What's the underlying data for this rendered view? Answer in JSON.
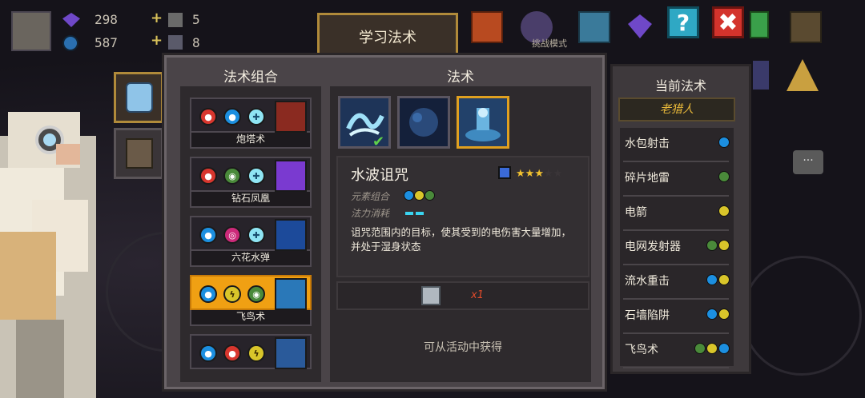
{
  "hud": {
    "gems": "298",
    "gold_coins": "587",
    "material_a": "5",
    "material_b": "8",
    "plus_a": "+",
    "plus_b": "+"
  },
  "buttons": {
    "learn_tab": "学习法术",
    "help": "?",
    "close": "✖",
    "chat": "···"
  },
  "background": {
    "mode_hint": "挑战模式"
  },
  "combos": {
    "title": "法术组合",
    "items": [
      {
        "name": "炮塔术",
        "elements": [
          "fire",
          "water",
          "ice"
        ],
        "art_color": "#8a2a20",
        "active": false
      },
      {
        "name": "钻石凤凰",
        "elements": [
          "fire",
          "earth",
          "ice"
        ],
        "art_color": "#7a3ad0",
        "active": false
      },
      {
        "name": "六花水弹",
        "elements": [
          "water",
          "poison",
          "ice"
        ],
        "art_color": "#1c4a9a",
        "active": false
      },
      {
        "name": "飞鸟术",
        "elements": [
          "water",
          "elec",
          "earth"
        ],
        "art_color": "#2a78b8",
        "active": true
      },
      {
        "name": "",
        "elements": [
          "water",
          "fire",
          "elec"
        ],
        "art_color": "#2a5a9a",
        "active": false
      }
    ]
  },
  "spells": {
    "title": "法术",
    "slots": [
      {
        "icon": "wave-spell-icon",
        "selected": false,
        "learned": true
      },
      {
        "icon": "dark-water-spell-icon",
        "selected": false,
        "learned": false
      },
      {
        "icon": "curse-spell-icon",
        "selected": true,
        "learned": false
      }
    ],
    "detail": {
      "name": "水波诅咒",
      "rarity_stars": 3,
      "max_stars": 5,
      "element_label": "元素组合",
      "mana_label": "法力消耗",
      "description": "诅咒范围内的目标，使其受到的电伤害大量增加，并处于湿身状态",
      "count": "x1",
      "obtain_hint": "可从活动中获得"
    }
  },
  "current": {
    "title": "当前法术",
    "character": "老猎人",
    "items": [
      {
        "name": "水包射击",
        "elements": [
          "water"
        ]
      },
      {
        "name": "碎片地雷",
        "elements": [
          "earth"
        ]
      },
      {
        "name": "电箭",
        "elements": [
          "elec"
        ]
      },
      {
        "name": "电网发射器",
        "elements": [
          "earth",
          "elec"
        ]
      },
      {
        "name": "流水重击",
        "elements": [
          "water",
          "elec"
        ]
      },
      {
        "name": "石墙陷阱",
        "elements": [
          "water",
          "elec"
        ]
      },
      {
        "name": "飞鸟术",
        "elements": [
          "earth",
          "elec",
          "water"
        ]
      }
    ]
  },
  "colors": {
    "fire": "#d8362e",
    "water": "#1c8fe0",
    "ice": "#8fe5f4",
    "earth": "#4a8a3a",
    "elec": "#d9c52a",
    "poison": "#cc2a7a",
    "gold_accent": "#f0a013"
  }
}
